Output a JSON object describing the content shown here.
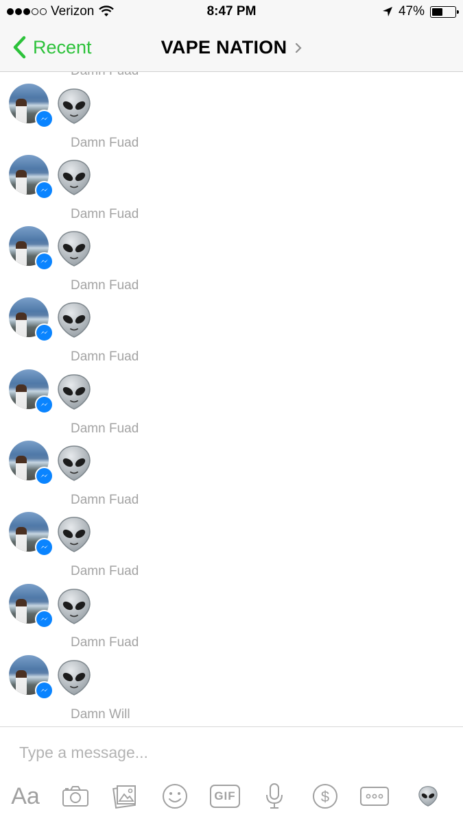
{
  "status_bar": {
    "carrier": "Verizon",
    "time": "8:47 PM",
    "battery": "47%",
    "battery_level": 0.47
  },
  "nav": {
    "back_label": "Recent",
    "title": "VAPE NATION"
  },
  "messages": [
    {
      "sender": "Damn Fuad",
      "content": "alien-emoji"
    },
    {
      "sender": "Damn Fuad",
      "content": "alien-emoji"
    },
    {
      "sender": "Damn Fuad",
      "content": "alien-emoji"
    },
    {
      "sender": "Damn Fuad",
      "content": "alien-emoji"
    },
    {
      "sender": "Damn Fuad",
      "content": "alien-emoji"
    },
    {
      "sender": "Damn Fuad",
      "content": "alien-emoji"
    },
    {
      "sender": "Damn Fuad",
      "content": "alien-emoji"
    },
    {
      "sender": "Damn Fuad",
      "content": "alien-emoji"
    },
    {
      "sender": "Damn Fuad",
      "content": "alien-emoji"
    },
    {
      "sender": "Damn Will",
      "content": ""
    }
  ],
  "composer": {
    "placeholder": "Type a message...",
    "text_format_label": "Aa",
    "gif_label": "GIF",
    "toolbar_icons": [
      "text-format-icon",
      "camera-icon",
      "photo-gallery-icon",
      "emoji-icon",
      "gif-icon",
      "microphone-icon",
      "payment-icon",
      "more-icon",
      "alien-icon"
    ]
  },
  "colors": {
    "accent": "#2cc23a",
    "messenger_badge": "#0a84ff",
    "sender_text": "#a3a3a3"
  }
}
